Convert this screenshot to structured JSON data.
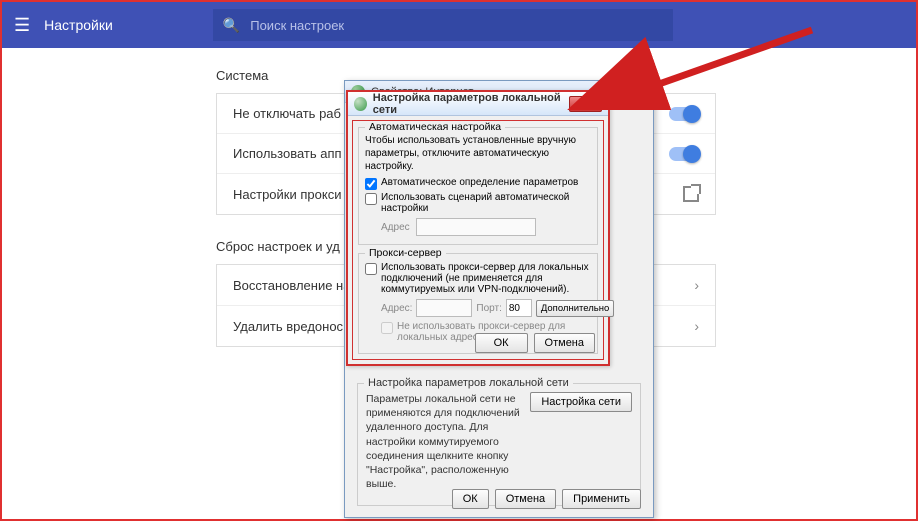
{
  "topbar": {
    "title": "Настройки",
    "search_placeholder": "Поиск настроек"
  },
  "section1": {
    "title": "Система",
    "rows": [
      {
        "label": "Не отключать раб"
      },
      {
        "label": "Использовать апп"
      },
      {
        "label": "Настройки прокси"
      }
    ]
  },
  "section2": {
    "title": "Сброс настроек и уд",
    "rows": [
      {
        "label": "Восстановление на"
      },
      {
        "label": "Удалить вредонос"
      }
    ]
  },
  "parent_dialog": {
    "title": "Свойства: Интернет",
    "help": "?",
    "lan_fieldset": {
      "legend": "Настройка параметров локальной сети",
      "desc": "Параметры локальной сети не применяются для подключений удаленного доступа. Для настройки коммутируемого соединения щелкните кнопку \"Настройка\", расположенную выше.",
      "button": "Настройка сети"
    },
    "footer": {
      "ok": "ОК",
      "cancel": "Отмена",
      "apply": "Применить"
    }
  },
  "lan_dialog": {
    "title": "Настройка параметров локальной сети",
    "auto": {
      "legend": "Автоматическая настройка",
      "desc": "Чтобы использовать установленные вручную параметры, отключите автоматическую настройку.",
      "auto_detect": "Автоматическое определение параметров",
      "use_script": "Использовать сценарий автоматической настройки",
      "address_label": "Адрес"
    },
    "proxy": {
      "legend": "Прокси-сервер",
      "use_proxy": "Использовать прокси-сервер для локальных подключений (не применяется для коммутируемых или VPN-подключений).",
      "address_label": "Адрес:",
      "port_label": "Порт:",
      "port_value": "80",
      "extra": "Дополнительно",
      "bypass": "Не использовать прокси-сервер для локальных адресов"
    },
    "ok": "ОК",
    "cancel": "Отмена"
  }
}
